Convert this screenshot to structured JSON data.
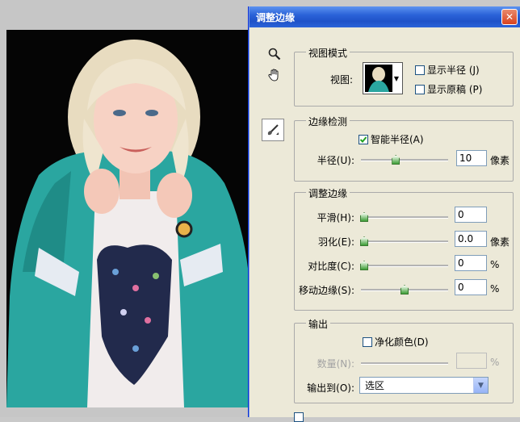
{
  "dialog": {
    "title": "调整边缘"
  },
  "view_mode": {
    "legend": "视图模式",
    "view_label": "视图:",
    "show_radius": "显示半径 (J)",
    "show_original": "显示原稿 (P)"
  },
  "edge_detection": {
    "legend": "边缘检测",
    "smart_radius": "智能半径(A)",
    "radius_label": "半径(U):",
    "radius_value": "10",
    "radius_unit": "像素",
    "radius_slider_fraction": 0.4
  },
  "adjust_edge": {
    "legend": "调整边缘",
    "smooth_label": "平滑(H):",
    "smooth_value": "0",
    "feather_label": "羽化(E):",
    "feather_value": "0.0",
    "feather_unit": "像素",
    "contrast_label": "对比度(C):",
    "contrast_value": "0",
    "contrast_unit": "%",
    "shift_label": "移动边缘(S):",
    "shift_value": "0",
    "shift_unit": "%",
    "shift_slider_fraction": 0.5
  },
  "output": {
    "legend": "输出",
    "decontaminate": "净化颜色(D)",
    "amount_label": "数量(N):",
    "amount_unit": "%",
    "output_to_label": "输出到(O):",
    "output_to_value": "选区"
  },
  "colors": {
    "title_bar": "#2b63d8",
    "dialog_bg": "#ece9d8",
    "checkmark": "#21a121"
  }
}
